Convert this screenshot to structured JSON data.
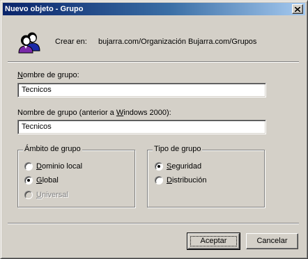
{
  "window": {
    "title": "Nuevo objeto - Grupo",
    "close_glyph": "✕"
  },
  "header": {
    "icon": "group-users-icon",
    "create_in_label": "Crear en:",
    "create_in_value": "bujarra.com/Organización Bujarra.com/Grupos"
  },
  "group_name": {
    "label_pre": "",
    "label_key": "N",
    "label_post": "ombre de grupo:",
    "value": "Tecnicos"
  },
  "group_name_pre2000": {
    "label_pre": "Nombre de grupo (anterior a ",
    "label_key": "W",
    "label_post": "indows 2000):",
    "value": "Tecnicos"
  },
  "scope": {
    "title": "Ámbito de grupo",
    "options": [
      {
        "pre": "",
        "key": "D",
        "post": "ominio local",
        "checked": false,
        "disabled": false
      },
      {
        "pre": "",
        "key": "G",
        "post": "lobal",
        "checked": true,
        "disabled": false
      },
      {
        "pre": "",
        "key": "U",
        "post": "niversal",
        "checked": false,
        "disabled": true
      }
    ]
  },
  "type": {
    "title": "Tipo de grupo",
    "options": [
      {
        "pre": "",
        "key": "S",
        "post": "eguridad",
        "checked": true
      },
      {
        "pre": "",
        "key": "D",
        "post": "istribución",
        "checked": false
      }
    ]
  },
  "buttons": {
    "ok": "Aceptar",
    "cancel": "Cancelar"
  },
  "colors": {
    "titlebar_start": "#0a246a",
    "titlebar_end": "#a6caf0",
    "face": "#d4d0c8"
  }
}
